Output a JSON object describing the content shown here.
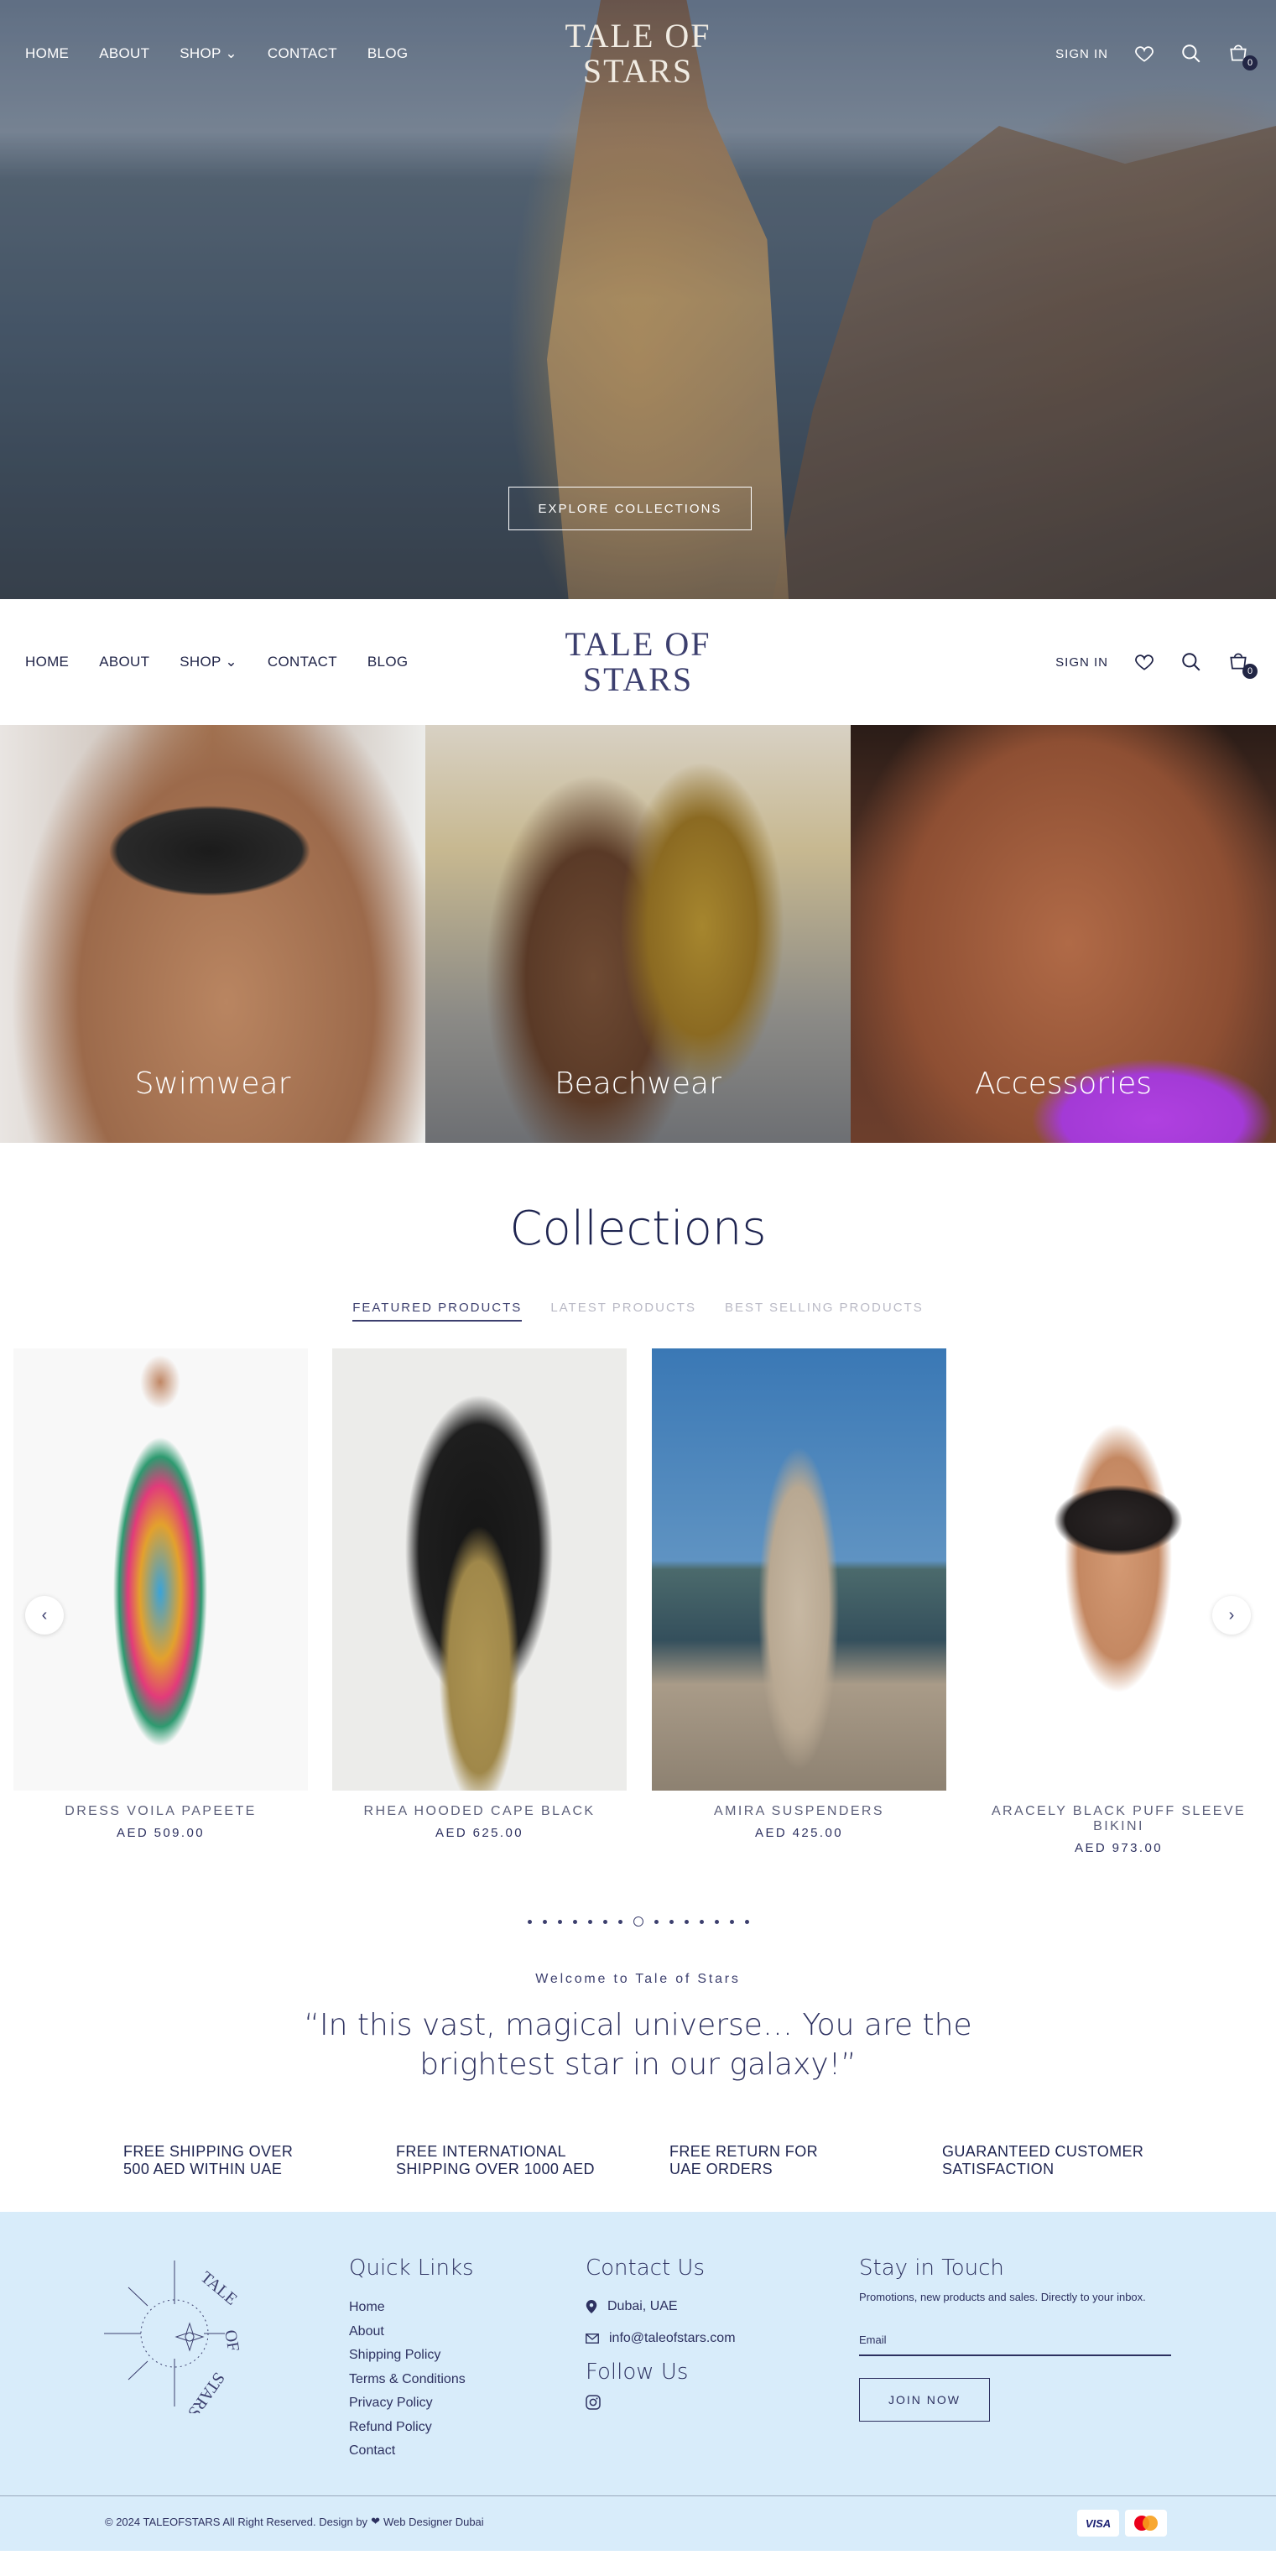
{
  "nav": {
    "home": "HOME",
    "about": "ABOUT",
    "shop": "SHOP",
    "contact": "CONTACT",
    "blog": "BLOG",
    "sign_in": "SIGN IN",
    "cart_count": "0",
    "logo_line1": "TALE OF",
    "logo_line2": "STARS"
  },
  "hero": {
    "cta": "EXPLORE COLLECTIONS"
  },
  "categories": [
    {
      "label": "Swimwear"
    },
    {
      "label": "Beachwear"
    },
    {
      "label": "Accessories"
    }
  ],
  "collections": {
    "title": "Collections",
    "tabs": [
      "FEATURED PRODUCTS",
      "LATEST PRODUCTS",
      "BEST SELLING PRODUCTS"
    ],
    "active_tab": "FEATURED PRODUCTS",
    "products": [
      {
        "name": "DRESS VOILA PAPEETE",
        "price": "AED  509.00"
      },
      {
        "name": "RHEA HOODED CAPE BLACK",
        "price": "AED  625.00"
      },
      {
        "name": "AMIRA SUSPENDERS",
        "price": "AED  425.00"
      },
      {
        "name": "ARACELY BLACK PUFF SLEEVE BIKINI",
        "price": "AED  973.00"
      }
    ],
    "pagination": {
      "total": 15,
      "active": 8
    }
  },
  "welcome": {
    "kicker": "Welcome to Tale of Stars",
    "quote": "“In this vast, magical universe… You are the brightest star in our galaxy!”"
  },
  "features": [
    "FREE SHIPPING OVER 500 AED WITHIN UAE",
    "FREE INTERNATIONAL SHIPPING OVER 1000 AED",
    "FREE RETURN FOR UAE ORDERS",
    "GUARANTEED CUSTOMER SATISFACTION"
  ],
  "footer": {
    "emblem_text": "TALE OF STARS",
    "quick_links_title": "Quick Links",
    "quick_links": [
      "Home",
      "About",
      "Shipping Policy",
      "Terms & Conditions",
      "Privacy Policy",
      "Refund Policy",
      "Contact"
    ],
    "contact_title": "Contact Us",
    "location": "Dubai, UAE",
    "email": "info@taleofstars.com",
    "follow_title": "Follow Us",
    "stay_title": "Stay in Touch",
    "promo": "Promotions, new products and sales. Directly to your inbox.",
    "email_placeholder": "Email",
    "join_label": "JOIN NOW",
    "copyright_prefix": "© 2024 TALEOFSTARS All Right Reserved. Design by",
    "designer": "Web Designer Dubai",
    "payments": {
      "visa": "VISA",
      "mastercard": "mastercard"
    }
  },
  "colors": {
    "brand_navy": "#2d3160",
    "footer_bg": "#d8ecfa",
    "tab_inactive": "#b9b9c5"
  }
}
